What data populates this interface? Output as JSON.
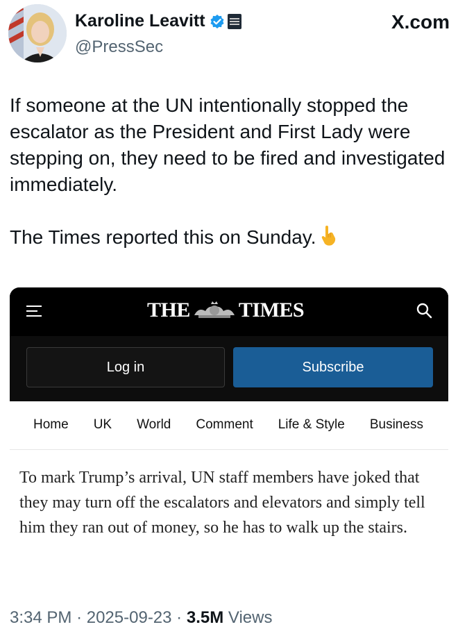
{
  "author": {
    "display_name": "Karoline Leavitt",
    "handle": "@PressSec",
    "site": "X.com"
  },
  "tweet": {
    "paragraph1": "If someone at the UN intentionally stopped the escalator as the President and First Lady were stepping on, they need to be fired and investigated immediately.",
    "paragraph2": "The Times reported this on Sunday."
  },
  "times_card": {
    "logo_left": "THE",
    "logo_right": "TIMES",
    "login_label": "Log in",
    "subscribe_label": "Subscribe",
    "nav": [
      "Home",
      "UK",
      "World",
      "Comment",
      "Life & Style",
      "Business"
    ],
    "article_text": "To mark Trump’s arrival, UN staff members have joked that they may turn off the escalators and elevators and simply tell him they ran out of money, so he has to walk up the stairs."
  },
  "meta": {
    "time": "3:34 PM",
    "date": "2025-09-23",
    "separator": "·",
    "views_count": "3.5M",
    "views_label": "Views"
  },
  "colors": {
    "verified_blue": "#1d9bf0",
    "subscribe_blue": "#1a5d96",
    "secondary_text": "#536471"
  }
}
